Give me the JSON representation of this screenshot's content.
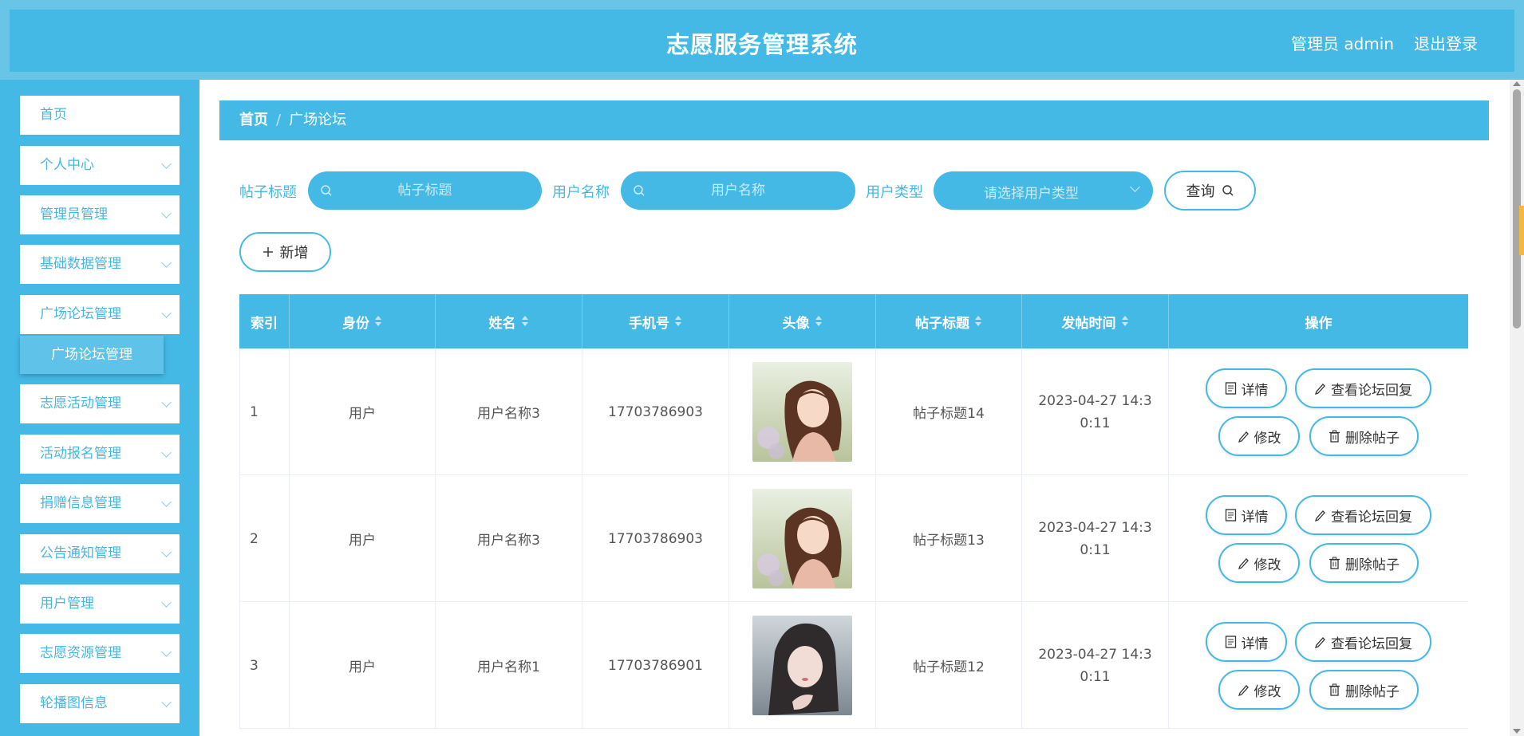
{
  "header": {
    "title": "志愿服务管理系统",
    "admin": "管理员 admin",
    "logout": "退出登录"
  },
  "sidebar": {
    "items": [
      {
        "label": "首页",
        "expandable": false
      },
      {
        "label": "个人中心",
        "expandable": true
      },
      {
        "label": "管理员管理",
        "expandable": true
      },
      {
        "label": "基础数据管理",
        "expandable": true
      },
      {
        "label": "广场论坛管理",
        "expandable": true
      },
      {
        "label": "志愿活动管理",
        "expandable": true
      },
      {
        "label": "活动报名管理",
        "expandable": true
      },
      {
        "label": "捐赠信息管理",
        "expandable": true
      },
      {
        "label": "公告通知管理",
        "expandable": true
      },
      {
        "label": "用户管理",
        "expandable": true
      },
      {
        "label": "志愿资源管理",
        "expandable": true
      },
      {
        "label": "轮播图信息",
        "expandable": true
      }
    ],
    "active_sub": "广场论坛管理"
  },
  "breadcrumb": {
    "home": "首页",
    "separator": "/",
    "current": "广场论坛"
  },
  "filters": {
    "title_label": "帖子标题",
    "title_placeholder": "帖子标题",
    "user_label": "用户名称",
    "user_placeholder": "用户名称",
    "type_label": "用户类型",
    "type_placeholder": "请选择用户类型",
    "query_button": "查询"
  },
  "add_button": "新增",
  "table": {
    "columns": [
      "索引",
      "身份",
      "姓名",
      "手机号",
      "头像",
      "帖子标题",
      "发帖时间",
      "操作"
    ],
    "rows": [
      {
        "index": "1",
        "role": "用户",
        "name": "用户名称3",
        "phone": "17703786903",
        "title": "帖子标题14",
        "time": "2023-04-27 14:30:11"
      },
      {
        "index": "2",
        "role": "用户",
        "name": "用户名称3",
        "phone": "17703786903",
        "title": "帖子标题13",
        "time": "2023-04-27 14:30:11"
      },
      {
        "index": "3",
        "role": "用户",
        "name": "用户名称1",
        "phone": "17703786901",
        "title": "帖子标题12",
        "time": "2023-04-27 14:30:11"
      }
    ],
    "actions": {
      "detail": "详情",
      "replies": "查看论坛回复",
      "edit": "修改",
      "delete": "删除帖子"
    }
  },
  "colors": {
    "primary": "#44b9e6",
    "header_outer": "#69c5e8",
    "sidebar_text": "#4ab6e0"
  }
}
